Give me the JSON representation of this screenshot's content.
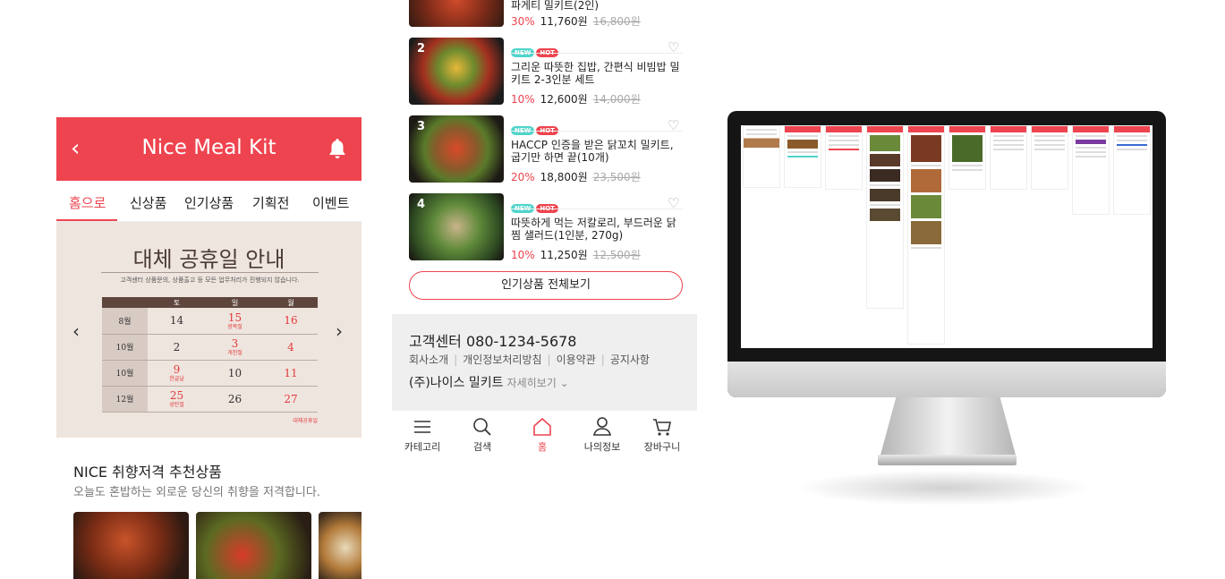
{
  "app": {
    "title": "Nice Meal Kit"
  },
  "colors": {
    "brand": "#ee444f",
    "new_badge": "#4fd4cb"
  },
  "left": {
    "back_icon": "chevron-left-icon",
    "bell_icon": "bell-icon",
    "tabs": [
      "홈으로",
      "신상품",
      "인기상품",
      "기획전",
      "이벤트"
    ],
    "banner": {
      "title": "대체 공휴일 안내",
      "subtitle": "고객센터 상품문의, 상품출고 등 모든 업무처리가 진행되지 않습니다.",
      "headers": [
        "토",
        "일",
        "월"
      ],
      "rows": [
        {
          "month": "8월",
          "d1": "14",
          "d2": "15",
          "d2_note": "광복절",
          "d3": "16"
        },
        {
          "month": "10월",
          "d1": "2",
          "d2": "3",
          "d2_note": "개천절",
          "d3": "4"
        },
        {
          "month": "10월",
          "d1": "9",
          "d1_note": "한글날",
          "d2": "10",
          "d3": "11"
        },
        {
          "month": "12월",
          "d1": "25",
          "d1_note": "성탄절",
          "d2": "26",
          "d3": "27"
        }
      ],
      "note": "대체공휴일"
    },
    "recommend": {
      "title": "NICE 취향저격 추천상품",
      "subtitle": "오늘도 혼밥하는 외로운 당신의 취향을 저격합니다."
    }
  },
  "mid": {
    "top_item": {
      "name": "파게티 밀키트(2인)",
      "discount": "30%",
      "price": "11,760원",
      "original": "16,800원"
    },
    "items": [
      {
        "rank": "2",
        "badges": [
          "NEW",
          "HOT"
        ],
        "name": "그리운 따뜻한 집밥, 간편식 비빔밥 밀키트 2-3인분 세트",
        "discount": "10%",
        "price": "12,600원",
        "original": "14,000원"
      },
      {
        "rank": "3",
        "badges": [
          "NEW",
          "HOT"
        ],
        "name": "HACCP 인증을 받은 닭꼬치 밀키트, 굽기만 하면 끝(10개)",
        "discount": "20%",
        "price": "18,800원",
        "original": "23,500원"
      },
      {
        "rank": "4",
        "badges": [
          "NEW",
          "HOT"
        ],
        "name": "따뜻하게 먹는 저칼로리, 부드러운 닭찜 샐러드(1인분, 270g)",
        "discount": "10%",
        "price": "11,250원",
        "original": "12,500원"
      }
    ],
    "view_all": "인기상품 전체보기",
    "footer": {
      "cs": "고객센터 080-1234-5678",
      "links": [
        "회사소개",
        "개인정보처리방침",
        "이용약관",
        "공지사항"
      ],
      "company": "(주)나이스 밀키트",
      "more": "자세히보기"
    },
    "nav": [
      {
        "label": "카테고리",
        "icon": "menu-icon"
      },
      {
        "label": "검색",
        "icon": "search-icon"
      },
      {
        "label": "홈",
        "icon": "home-icon"
      },
      {
        "label": "나의정보",
        "icon": "user-icon"
      },
      {
        "label": "장바구니",
        "icon": "cart-icon"
      }
    ]
  }
}
